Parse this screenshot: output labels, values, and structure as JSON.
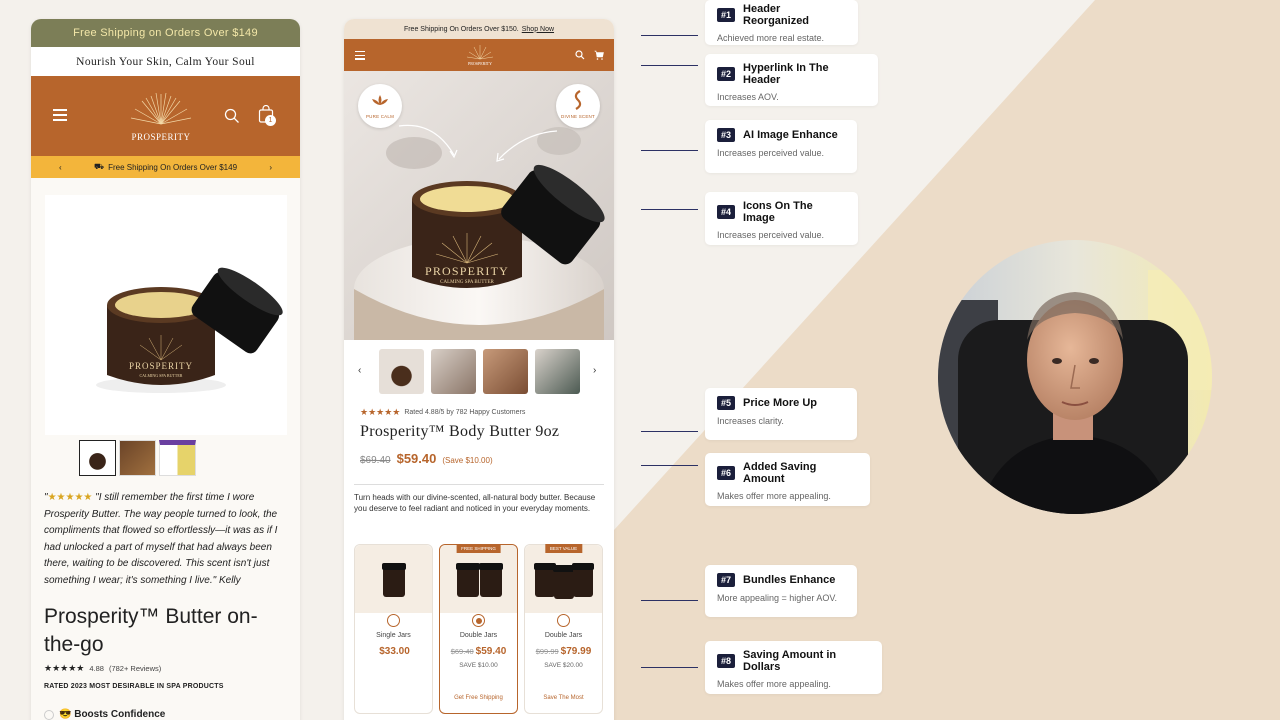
{
  "colors": {
    "brand": "#b7652c",
    "olive": "#7c7e57",
    "yellow_bar": "#f3b53b",
    "annotation_badge": "#1b1f3b",
    "background_cream": "#f4f1ec",
    "background_beige": "#ecdcc8"
  },
  "left_phone": {
    "ship_bar": "Free Shipping on Orders Over $149",
    "tagline": "Nourish Your Skin, Calm Your Soul",
    "logo_text": "PROSPERITY",
    "cart_count": "1",
    "promo_bar": "Free Shipping On Orders Over $149",
    "review_open": "\"",
    "review_text": "\"I still remember the first time I wore Prosperity Butter. The way people turned to look, the compliments that flowed so effortlessly—it was as if I had unlocked a part of myself that had always been there, waiting to be discovered. This scent isn't just something I wear; it's something I live.\" Kelly",
    "title": "Prosperity™ Butter on-the-go",
    "rating_value": "4.88",
    "review_count": "(782+ Reviews)",
    "rated_text": "RATED 2023 MOST DESIRABLE IN SPA PRODUCTS",
    "boost": "😎 Boosts Confidence"
  },
  "center_phone": {
    "ship_text": "Free Shipping On Orders Over $150.",
    "ship_link": "Shop Now",
    "logo_text": "PROSPERITY",
    "badge_1": "PURE CALM",
    "badge_2": "DIVINE SCENT",
    "jar_label": "PROSPERITY",
    "jar_sub": "CALMING SPA BUTTER",
    "rating_text": "Rated 4.88/5 by 782 Happy Customers",
    "title": "Prosperity™ Body Butter 9oz",
    "old_price": "$69.40",
    "new_price": "$59.40",
    "save": "(Save $10.00)",
    "description": "Turn heads with our divine-scented, all-natural body butter. Because you deserve to feel radiant and noticed in your everyday moments.",
    "bundles": [
      {
        "tag": "",
        "name": "Single Jars",
        "old_price": "",
        "price": "$33.00",
        "save": "",
        "cta": ""
      },
      {
        "tag": "FREE SHIPPING",
        "name": "Double Jars",
        "old_price": "$69.40",
        "price": "$59.40",
        "save": "SAVE $10.00",
        "cta": "Get Free Shipping"
      },
      {
        "tag": "BEST VALUE",
        "name": "Double Jars",
        "old_price": "$99.99",
        "price": "$79.99",
        "save": "SAVE $20.00",
        "cta": "Save The Most"
      }
    ]
  },
  "annotations": [
    {
      "num": "#1",
      "title": "Header Reorganized",
      "sub": "Achieved more real estate."
    },
    {
      "num": "#2",
      "title": "Hyperlink In The Header",
      "sub": "Increases AOV."
    },
    {
      "num": "#3",
      "title": "AI Image Enhance",
      "sub": "Increases perceived value."
    },
    {
      "num": "#4",
      "title": "Icons On The Image",
      "sub": "Increases perceived value."
    },
    {
      "num": "#5",
      "title": "Price More Up",
      "sub": "Increases clarity."
    },
    {
      "num": "#6",
      "title": "Added Saving Amount",
      "sub": "Makes offer more appealing."
    },
    {
      "num": "#7",
      "title": "Bundles Enhance",
      "sub": "More appealing = higher AOV."
    },
    {
      "num": "#8",
      "title": "Saving Amount in Dollars",
      "sub": "Makes offer more appealing."
    }
  ]
}
